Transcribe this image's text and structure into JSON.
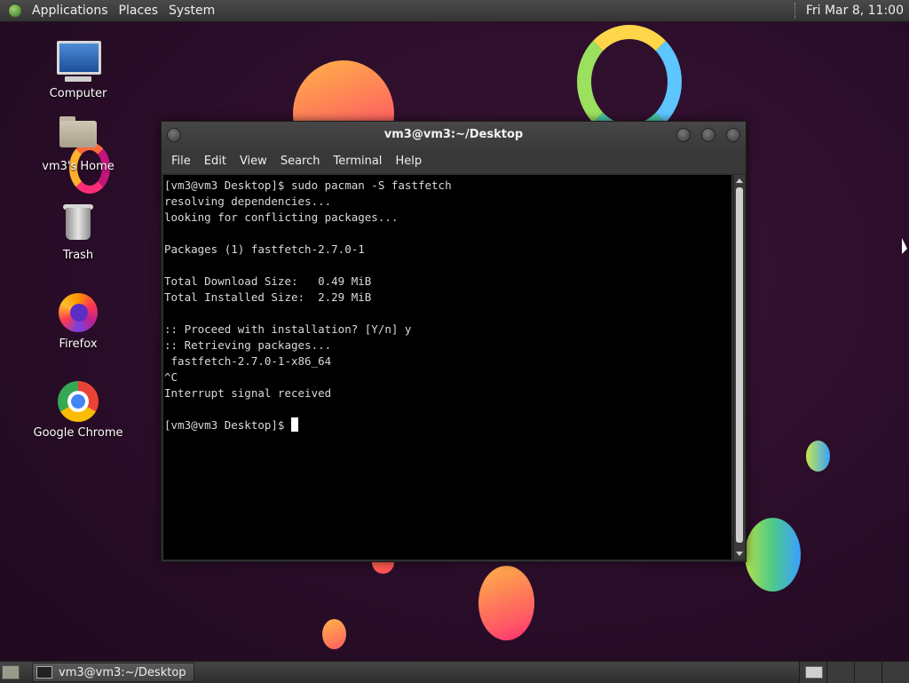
{
  "top_panel": {
    "menus": [
      "Applications",
      "Places",
      "System"
    ],
    "clock": "Fri Mar  8, 11:00"
  },
  "desktop_icons": [
    {
      "label": "Computer",
      "icon": "computer-icon"
    },
    {
      "label": "vm3's Home",
      "icon": "home-folder-icon"
    },
    {
      "label": "Trash",
      "icon": "trash-icon"
    },
    {
      "label": "Firefox",
      "icon": "firefox-icon"
    },
    {
      "label": "Google Chrome",
      "icon": "chrome-icon"
    }
  ],
  "terminal": {
    "title": "vm3@vm3:~/Desktop",
    "menu": [
      "File",
      "Edit",
      "View",
      "Search",
      "Terminal",
      "Help"
    ],
    "lines": [
      "[vm3@vm3 Desktop]$ sudo pacman -S fastfetch",
      "resolving dependencies...",
      "looking for conflicting packages...",
      "",
      "Packages (1) fastfetch-2.7.0-1",
      "",
      "Total Download Size:   0.49 MiB",
      "Total Installed Size:  2.29 MiB",
      "",
      ":: Proceed with installation? [Y/n] y",
      ":: Retrieving packages...",
      " fastfetch-2.7.0-1-x86_64",
      "^C",
      "Interrupt signal received",
      ""
    ],
    "prompt": "[vm3@vm3 Desktop]$ "
  },
  "taskbar": {
    "window_label": "vm3@vm3:~/Desktop"
  },
  "colors": {
    "background": "#2a0d29",
    "panel": "#3c3c3c",
    "terminal_bg": "#000000",
    "terminal_fg": "#d9d9d9"
  }
}
